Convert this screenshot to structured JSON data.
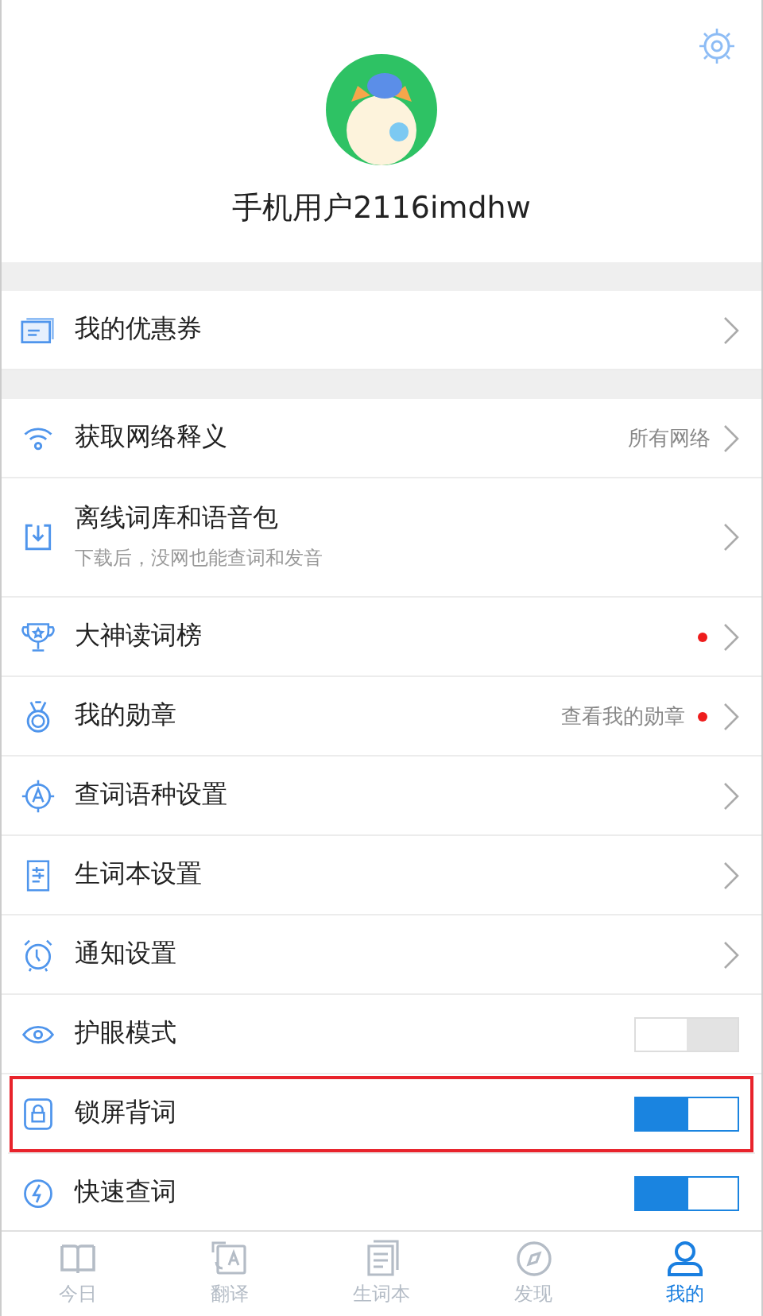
{
  "profile": {
    "username": "手机用户2116imdhw"
  },
  "coupon": {
    "label": "我的优惠券"
  },
  "settings": [
    {
      "kind": "link",
      "label": "获取网络释义",
      "value": "所有网络",
      "dot": false,
      "highlighted": false
    },
    {
      "kind": "link",
      "label": "离线词库和语音包",
      "subtitle": "下载后，没网也能查词和发音",
      "dot": false,
      "highlighted": false
    },
    {
      "kind": "link",
      "label": "大神读词榜",
      "dot": true,
      "highlighted": false
    },
    {
      "kind": "link",
      "label": "我的勋章",
      "value": "查看我的勋章",
      "dot": true,
      "highlighted": false
    },
    {
      "kind": "link",
      "label": "查词语种设置",
      "dot": false,
      "highlighted": false
    },
    {
      "kind": "link",
      "label": "生词本设置",
      "dot": false,
      "highlighted": false
    },
    {
      "kind": "link",
      "label": "通知设置",
      "dot": false,
      "highlighted": false
    },
    {
      "kind": "toggle",
      "label": "护眼模式",
      "on": false,
      "highlighted": false
    },
    {
      "kind": "toggle",
      "label": "锁屏背词",
      "on": true,
      "highlighted": true
    },
    {
      "kind": "toggle",
      "label": "快速查词",
      "on": true,
      "highlighted": false
    }
  ],
  "tabs": [
    {
      "label": "今日",
      "selected": false
    },
    {
      "label": "翻译",
      "selected": false
    },
    {
      "label": "生词本",
      "selected": false
    },
    {
      "label": "发现",
      "selected": false
    },
    {
      "label": "我的",
      "selected": true
    }
  ]
}
